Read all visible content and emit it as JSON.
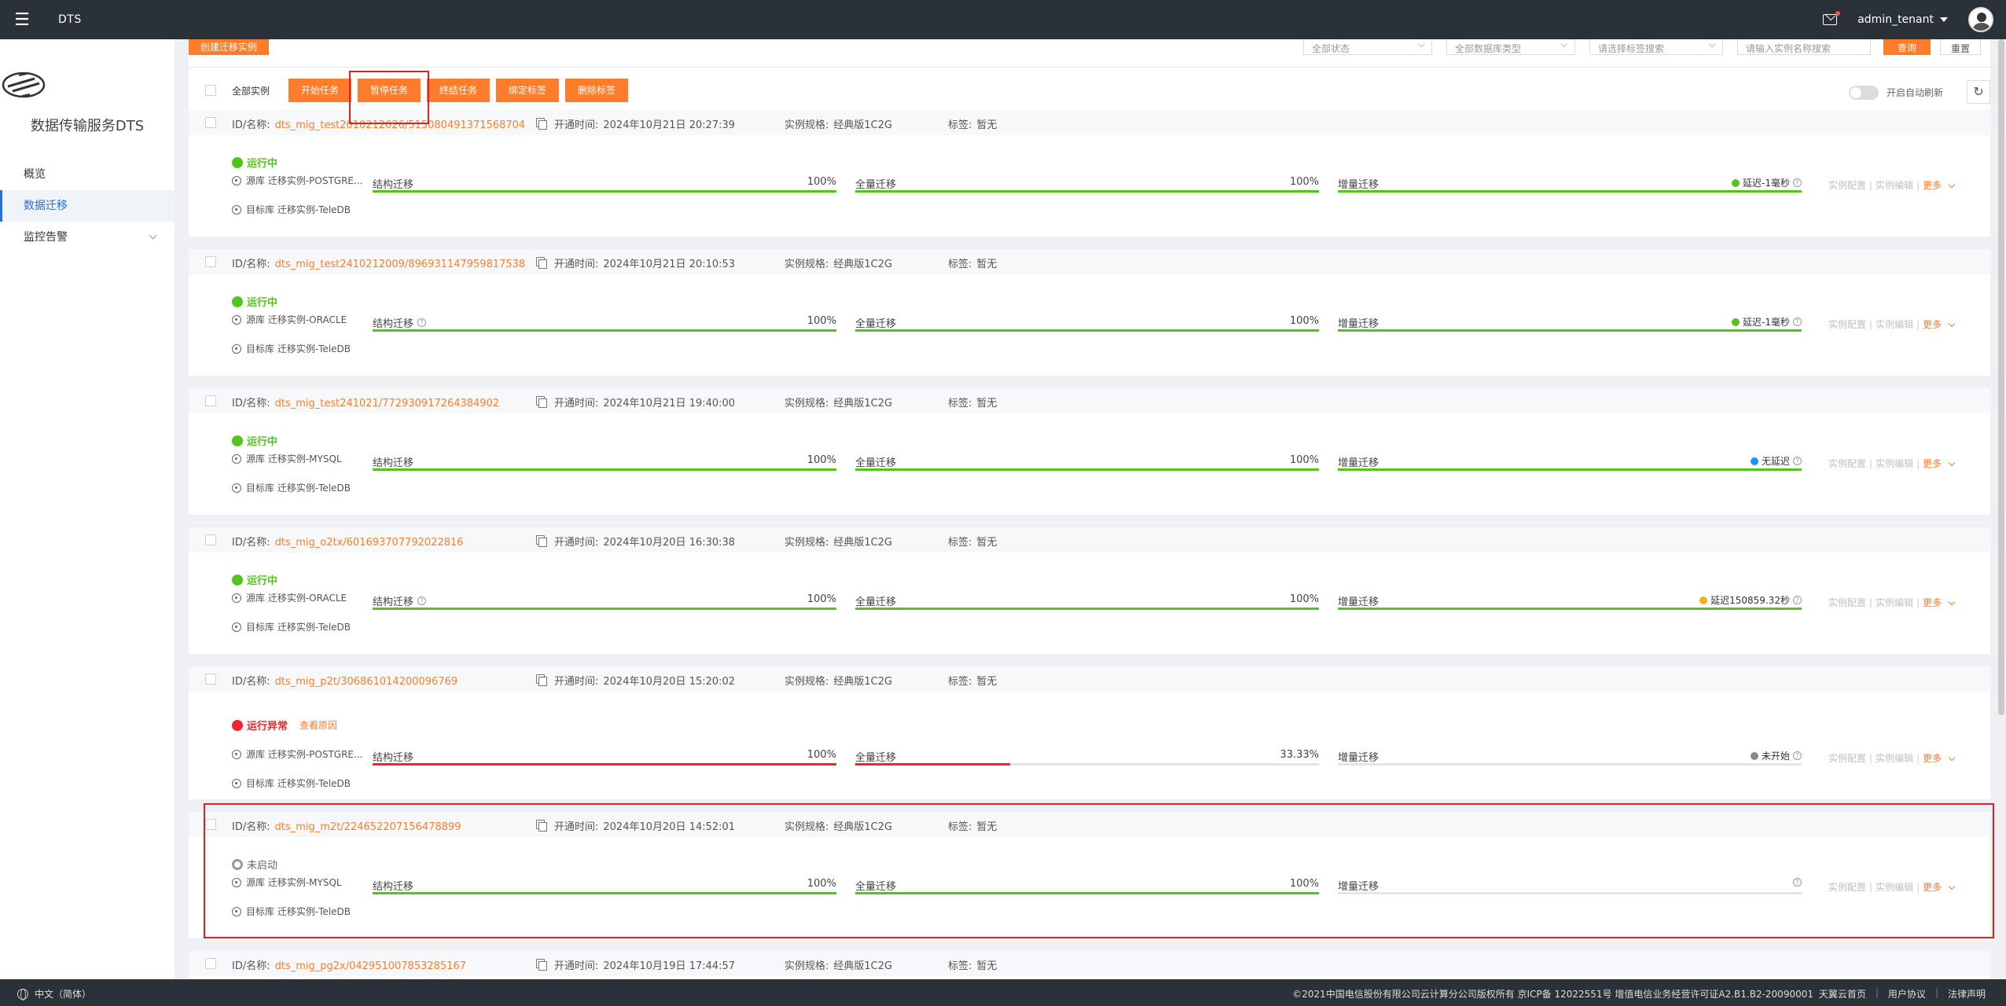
{
  "header": {
    "app_title": "DTS",
    "username": "admin_tenant"
  },
  "sidebar": {
    "service_name": "数据传输服务DTS",
    "items": [
      {
        "label": "概览"
      },
      {
        "label": "数据迁移"
      },
      {
        "label": "监控告警"
      }
    ]
  },
  "filterbar": {
    "create_label": "创建迁移实例",
    "status_select": "全部状态",
    "dbtype_select": "全部数据库类型",
    "tag_select": "请选择标签搜索",
    "search_placeholder": "请输入实例名称搜索",
    "query_label": "查询",
    "reset_label": "重置"
  },
  "toolbar": {
    "select_all_label": "全部实例",
    "start_label": "开始任务",
    "pause_label": "暂停任务",
    "stop_label": "终结任务",
    "bind_tag_label": "绑定标签",
    "delete_tag_label": "删除标签",
    "auto_refresh_label": "开启自动刷新",
    "auto_refresh_on": false
  },
  "labels": {
    "id_prefix": "ID/名称:",
    "open_time_prefix": "开通时间:",
    "spec_prefix": "实例规格:",
    "tag_prefix": "标签:",
    "structure": "结构迁移",
    "full": "全量迁移",
    "incremental": "增量迁移",
    "op_config": "实例配置",
    "op_edit": "实例编辑",
    "op_more": "更多",
    "sep": "|"
  },
  "colors": {
    "accent": "#ff7d2a",
    "running": "#52c41a",
    "error": "#f5222d",
    "notstarted": "#999999"
  },
  "tasks": [
    {
      "id": "dts_mig_test2010212026/515080491371568704",
      "open_time": "2024年10月21日 20:27:39",
      "spec": "经典版1C2G",
      "tag": "暂无",
      "status": "运行中",
      "status_kind": "running",
      "status_extra": "",
      "src": "源库 迁移实例-POSTGRE...",
      "dst": "目标库 迁移实例-TeleDB",
      "structure_pct": "100%",
      "structure_progress": 1.0,
      "structure_help": false,
      "full_pct": "100%",
      "full_progress": 1.0,
      "incr_progress": 1.0,
      "lag": "延迟-1毫秒",
      "lag_kind": "green"
    },
    {
      "id": "dts_mig_test2410212009/896931147959817538",
      "open_time": "2024年10月21日 20:10:53",
      "spec": "经典版1C2G",
      "tag": "暂无",
      "status": "运行中",
      "status_kind": "running",
      "status_extra": "",
      "src": "源库 迁移实例-ORACLE",
      "dst": "目标库 迁移实例-TeleDB",
      "structure_pct": "100%",
      "structure_progress": 1.0,
      "structure_help": true,
      "full_pct": "100%",
      "full_progress": 1.0,
      "incr_progress": 1.0,
      "lag": "延迟-1毫秒",
      "lag_kind": "green"
    },
    {
      "id": "dts_mig_test241021/772930917264384902",
      "open_time": "2024年10月21日 19:40:00",
      "spec": "经典版1C2G",
      "tag": "暂无",
      "status": "运行中",
      "status_kind": "running",
      "status_extra": "",
      "src": "源库 迁移实例-MYSQL",
      "dst": "目标库 迁移实例-TeleDB",
      "structure_pct": "100%",
      "structure_progress": 1.0,
      "structure_help": false,
      "full_pct": "100%",
      "full_progress": 1.0,
      "incr_progress": 1.0,
      "lag": "无延迟",
      "lag_kind": "blue"
    },
    {
      "id": "dts_mig_o2tx/601693707792022816",
      "open_time": "2024年10月20日 16:30:38",
      "spec": "经典版1C2G",
      "tag": "暂无",
      "status": "运行中",
      "status_kind": "running",
      "status_extra": "",
      "src": "源库 迁移实例-ORACLE",
      "dst": "目标库 迁移实例-TeleDB",
      "structure_pct": "100%",
      "structure_progress": 1.0,
      "structure_help": true,
      "full_pct": "100%",
      "full_progress": 1.0,
      "incr_progress": 1.0,
      "lag": "延迟150859.32秒",
      "lag_kind": "orange"
    },
    {
      "id": "dts_mig_p2t/306861014200096769",
      "open_time": "2024年10月20日 15:20:02",
      "spec": "经典版1C2G",
      "tag": "暂无",
      "status": "运行异常",
      "status_kind": "error",
      "status_extra": "查看原因",
      "src": "源库 迁移实例-POSTGRE...",
      "dst": "目标库 迁移实例-TeleDB",
      "structure_pct": "100%",
      "structure_progress": 1.0,
      "structure_help": false,
      "full_pct": "33.33%",
      "full_progress": 0.3333,
      "incr_progress": 0.0,
      "lag": "未开始",
      "lag_kind": "gray"
    },
    {
      "id": "dts_mig_m2t/224652207156478899",
      "open_time": "2024年10月20日 14:52:01",
      "spec": "经典版1C2G",
      "tag": "暂无",
      "status": "未启动",
      "status_kind": "notstarted",
      "status_extra": "",
      "src": "源库 迁移实例-MYSQL",
      "dst": "目标库 迁移实例-TeleDB",
      "structure_pct": "100%",
      "structure_progress": 1.0,
      "structure_help": false,
      "full_pct": "100%",
      "full_progress": 1.0,
      "incr_progress": 0.0,
      "lag": "",
      "lag_kind": "none"
    },
    {
      "id": "dts_mig_pg2x/042951007853285167",
      "open_time": "2024年10月19日 17:44:57",
      "spec": "经典版1C2G",
      "tag": "暂无",
      "status": "",
      "status_kind": "",
      "status_extra": "",
      "src": "",
      "dst": "",
      "structure_pct": "",
      "structure_progress": 0,
      "structure_help": false,
      "full_pct": "",
      "full_progress": 0,
      "incr_progress": 0,
      "lag": "",
      "lag_kind": "none"
    }
  ],
  "footer": {
    "language": "中文（简体）",
    "copyright": "©2021中国电信股份有限公司云计算分公司版权所有 京ICP备 12022551号 增值电信业务经营许可证A2.B1.B2-20090001",
    "links": [
      "天翼云首页",
      "用户协议",
      "法律声明"
    ]
  }
}
